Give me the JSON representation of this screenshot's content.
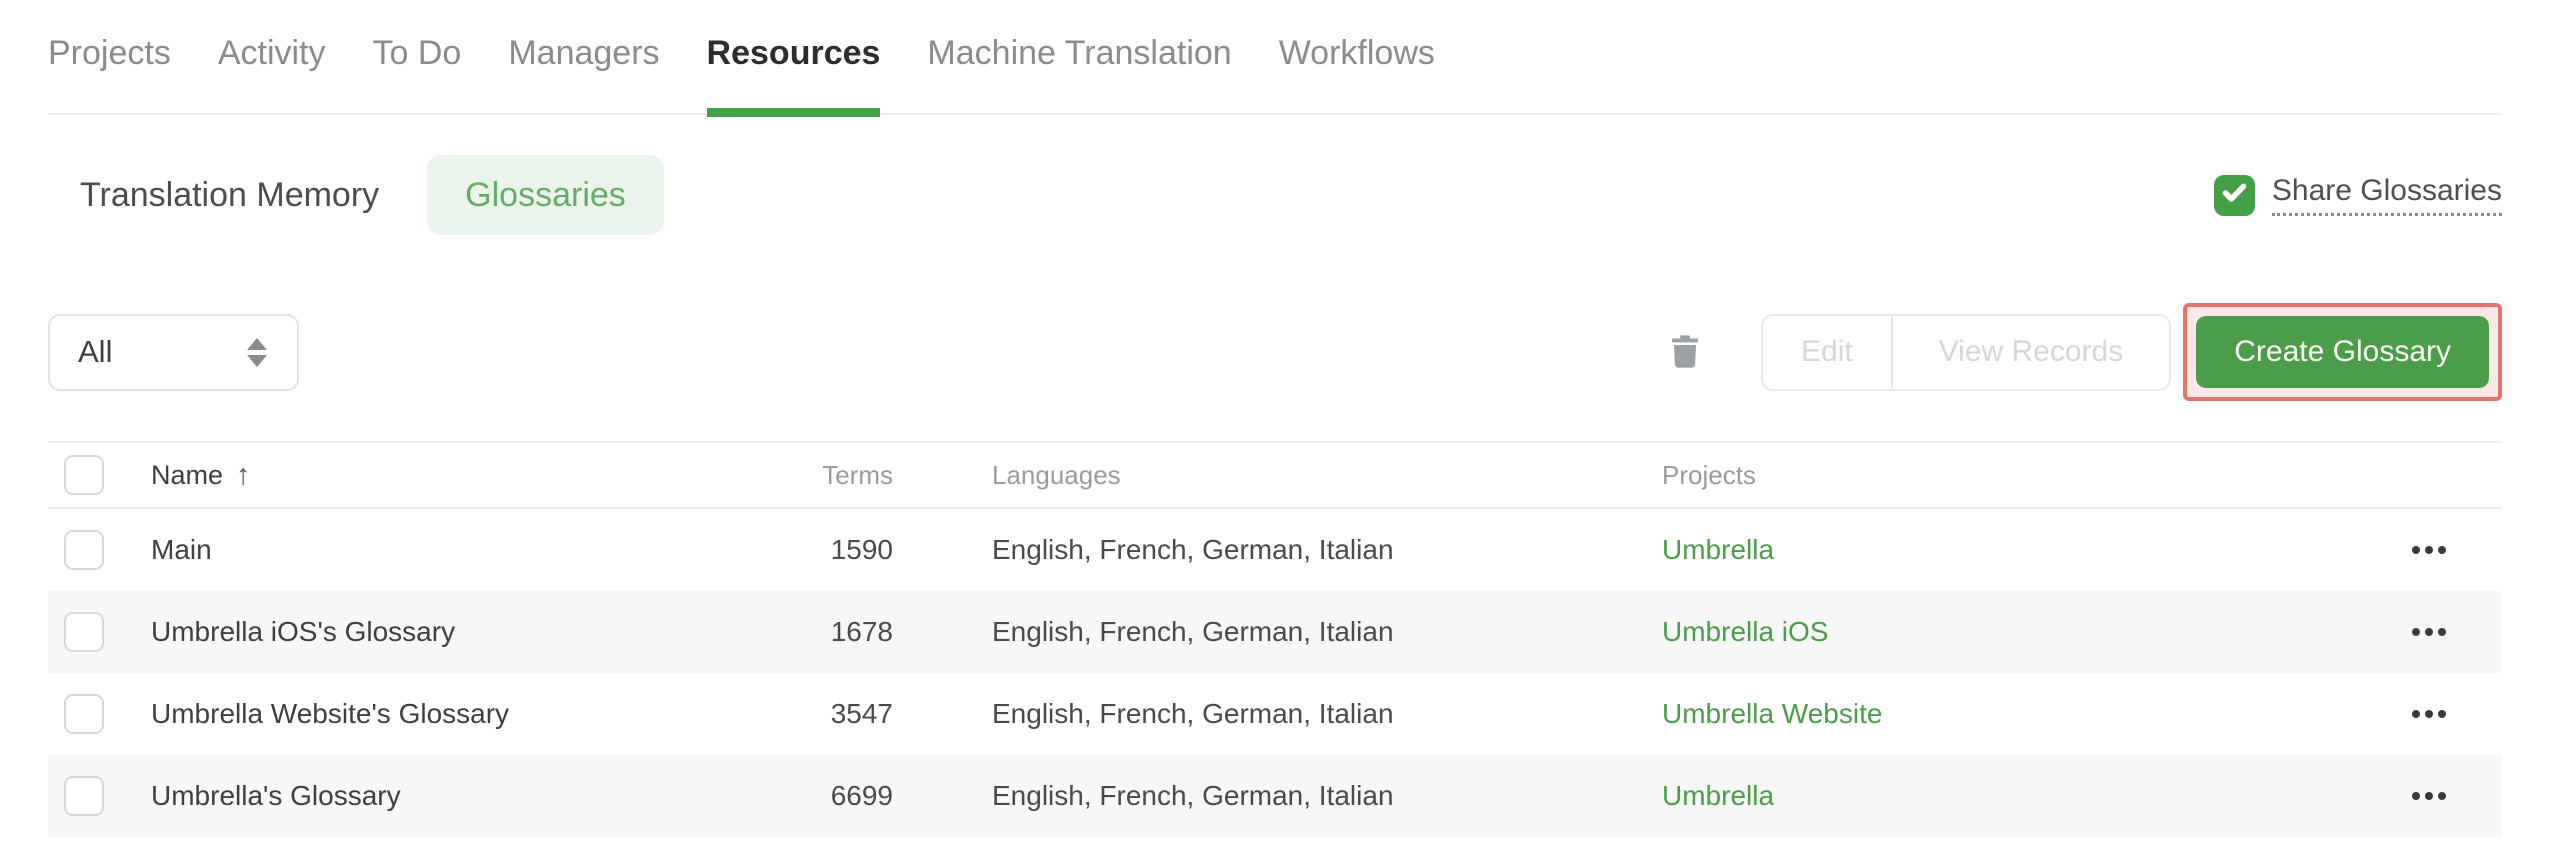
{
  "nav": {
    "tabs": [
      {
        "label": "Projects",
        "active": false
      },
      {
        "label": "Activity",
        "active": false
      },
      {
        "label": "To Do",
        "active": false
      },
      {
        "label": "Managers",
        "active": false
      },
      {
        "label": "Resources",
        "active": true
      },
      {
        "label": "Machine Translation",
        "active": false
      },
      {
        "label": "Workflows",
        "active": false
      }
    ]
  },
  "subnav": {
    "tabs": [
      {
        "label": "Translation Memory",
        "active": false
      },
      {
        "label": "Glossaries",
        "active": true
      }
    ],
    "share": {
      "label": "Share Glossaries",
      "checked": true,
      "icon": "checkmark-icon"
    }
  },
  "toolbar": {
    "filter": {
      "value": "All",
      "icon": "sort-arrows-icon"
    },
    "delete_icon": "trash-icon",
    "edit_label": "Edit",
    "view_records_label": "View Records",
    "create_label": "Create Glossary"
  },
  "table": {
    "headers": {
      "name": "Name",
      "terms": "Terms",
      "languages": "Languages",
      "projects": "Projects"
    },
    "sort": {
      "column": "Name",
      "direction": "ascending",
      "icon": "↑"
    },
    "rows": [
      {
        "name": "Main",
        "terms": "1590",
        "languages": "English, French, German, Italian",
        "project": "Umbrella"
      },
      {
        "name": "Umbrella iOS's Glossary",
        "terms": "1678",
        "languages": "English, French, German, Italian",
        "project": "Umbrella iOS"
      },
      {
        "name": "Umbrella Website's Glossary",
        "terms": "3547",
        "languages": "English, French, German, Italian",
        "project": "Umbrella Website"
      },
      {
        "name": "Umbrella's Glossary",
        "terms": "6699",
        "languages": "English, French, German, Italian",
        "project": "Umbrella"
      }
    ]
  },
  "colors": {
    "accent_green": "#43a047",
    "button_green": "#4b9d49",
    "link_green": "#4a9d49",
    "pill_bg": "#eaf4ea",
    "pill_text": "#64ad64",
    "annotation_border": "#e5746c",
    "annotation_bg": "#fce9e7",
    "row_stripe": "#f7f7f8"
  }
}
